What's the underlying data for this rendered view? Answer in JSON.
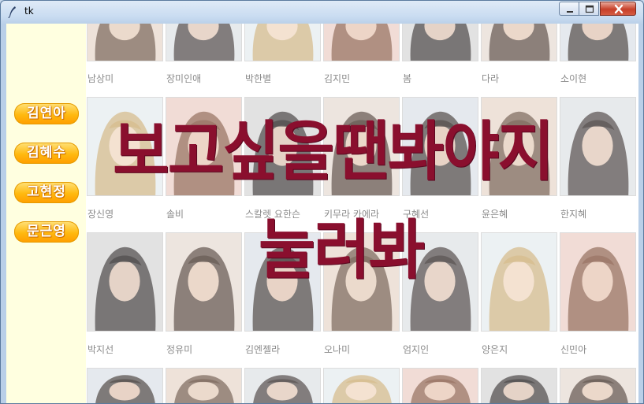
{
  "window": {
    "title": "tk"
  },
  "colors": {
    "sidebar_bg": "#ffffe0",
    "button_gold": "#ffb90f",
    "overlay_text": "#8a0f2e"
  },
  "sidebar": {
    "buttons": [
      {
        "label": "김연아"
      },
      {
        "label": "김혜수"
      },
      {
        "label": "고현정"
      },
      {
        "label": "문근영"
      }
    ]
  },
  "gallery": {
    "rows": [
      {
        "names": [
          "남상미",
          "장미인애",
          "박한별",
          "김지민",
          "봄",
          "다라",
          "소이현"
        ]
      },
      {
        "names": [
          "장신영",
          "솔비",
          "스칼렛 요한슨",
          "키무라 카에라",
          "구혜선",
          "윤은혜",
          "한지혜"
        ]
      },
      {
        "names": [
          "박지선",
          "정유미",
          "김엔젤라",
          "오나미",
          "엄지인",
          "양은지",
          "신민아"
        ]
      },
      {
        "names": []
      }
    ]
  },
  "overlay": {
    "line1": "보고싶을땐봐야지",
    "line2": "눌러봐"
  }
}
